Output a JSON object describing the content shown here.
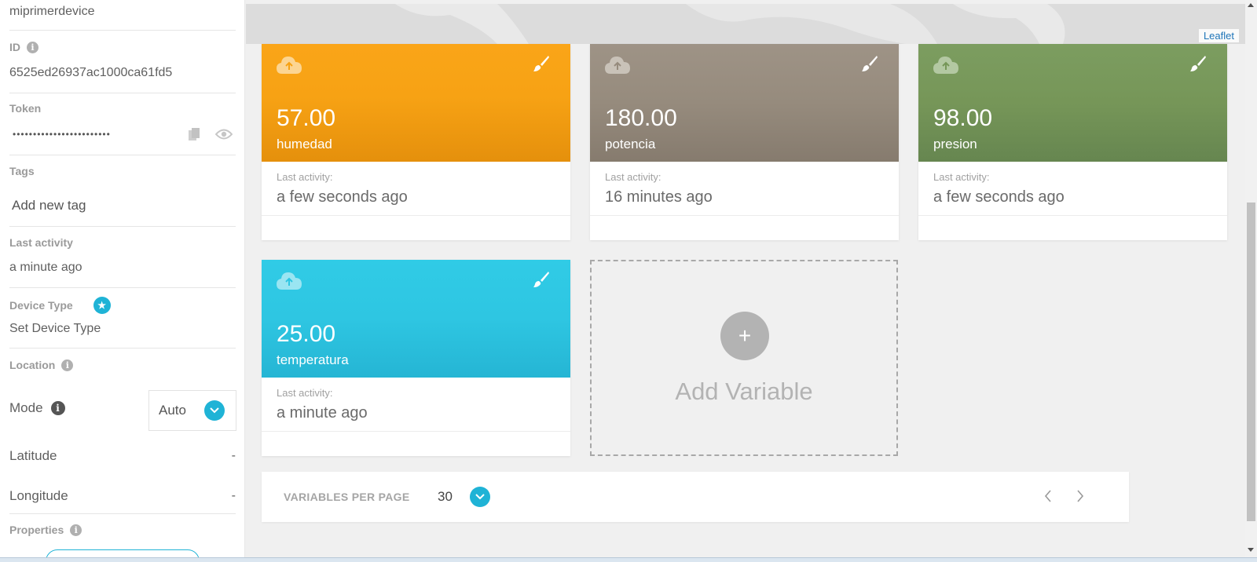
{
  "sidebar": {
    "device_name": "miprimerdevice",
    "id_label": "ID",
    "id_value": "6525ed26937ac1000ca61fd5",
    "token_label": "Token",
    "token_value": "••••••••••••••••••••••••",
    "tags_label": "Tags",
    "tags_placeholder": "Add new tag",
    "last_activity_label": "Last activity",
    "last_activity_value": "a minute ago",
    "device_type_label": "Device Type",
    "device_type_value": "Set Device Type",
    "location_label": "Location",
    "mode_label": "Mode",
    "mode_value": "Auto",
    "latitude_label": "Latitude",
    "latitude_value": "-",
    "longitude_label": "Longitude",
    "longitude_value": "-",
    "properties_label": "Properties"
  },
  "map": {
    "attribution": "Leaflet"
  },
  "variables": [
    {
      "value": "57.00",
      "name": "humedad",
      "last_activity_label": "Last activity:",
      "last_activity": "a few seconds ago",
      "color": "#f7a214"
    },
    {
      "value": "180.00",
      "name": "potencia",
      "last_activity_label": "Last activity:",
      "last_activity": "16 minutes ago",
      "color": "#968b7d"
    },
    {
      "value": "98.00",
      "name": "presion",
      "last_activity_label": "Last activity:",
      "last_activity": "a few seconds ago",
      "color": "#769658"
    },
    {
      "value": "25.00",
      "name": "temperatura",
      "last_activity_label": "Last activity:",
      "last_activity": "a minute ago",
      "color": "#2ec6e2"
    }
  ],
  "add_variable": {
    "icon": "+",
    "label": "Add Variable"
  },
  "pagination": {
    "label": "VARIABLES PER PAGE",
    "value": "30"
  },
  "colors": {
    "accent": "#1fb3d6"
  }
}
